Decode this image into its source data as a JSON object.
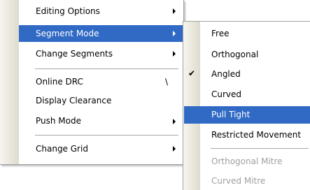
{
  "main_menu": {
    "items": [
      {
        "label": "Editing Options",
        "submenu": true
      },
      {
        "label": "Segment Mode",
        "submenu": true,
        "highlighted": true
      },
      {
        "label": "Change Segments",
        "submenu": true
      },
      {
        "label": "Online DRC",
        "shortcut": "\\"
      },
      {
        "label": "Display Clearance"
      },
      {
        "label": "Push Mode",
        "submenu": true
      },
      {
        "label": "Change Grid",
        "submenu": true
      }
    ]
  },
  "segment_mode_menu": {
    "items": [
      {
        "label": "Free"
      },
      {
        "label": "Orthogonal"
      },
      {
        "label": "Angled",
        "checked": true,
        "check_glyph": "✔"
      },
      {
        "label": "Curved"
      },
      {
        "label": "Pull Tight",
        "highlighted": true
      },
      {
        "label": "Restricted Movement"
      },
      {
        "label": "Orthogonal Mitre",
        "disabled": true
      },
      {
        "label": "Curved Mitre",
        "disabled": true
      }
    ]
  },
  "colors": {
    "highlight": "#316ac5",
    "disabled_text": "#a0a0a0",
    "icon_strip": "#dedbcd"
  }
}
